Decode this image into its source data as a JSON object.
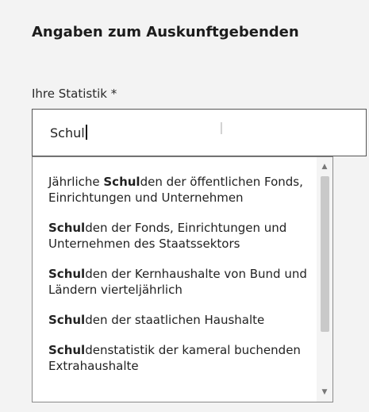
{
  "section": {
    "title": "Angaben zum Auskunftgebenden"
  },
  "statistik_field": {
    "label": "Ihre Statistik *",
    "value": "Schul"
  },
  "suggestions": [
    {
      "match": "Schul",
      "before": "Jährliche ",
      "after": "den der öffentlichen Fonds, Einrichtungen und Unternehmen"
    },
    {
      "match": "Schul",
      "before": "",
      "after": "den der Fonds, Einrichtungen und Unternehmen des Staatssektors"
    },
    {
      "match": "Schul",
      "before": "",
      "after": "den der Kernhaushalte von Bund und Ländern vierteljährlich"
    },
    {
      "match": "Schul",
      "before": "",
      "after": "den der staatlichen Haushalte"
    },
    {
      "match": "Schul",
      "before": "",
      "after": "denstatistik der kameral buchenden Extrahaushalte"
    }
  ],
  "icons": {
    "scroll_up": "chevron-up-icon",
    "scroll_down": "chevron-down-icon",
    "cursor": "text-cursor-icon"
  }
}
